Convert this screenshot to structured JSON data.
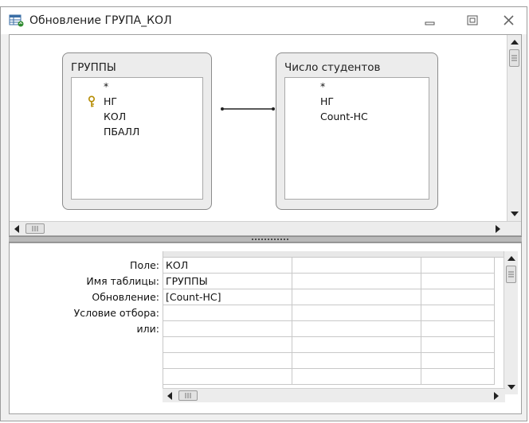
{
  "window": {
    "title": "Обновление ГРУПА_КОЛ"
  },
  "icons": {
    "title": "query-update-icon",
    "minimize": "minimize-icon",
    "maximize": "restore-icon",
    "close": "close-icon",
    "key": "primary-key-icon"
  },
  "tables": [
    {
      "name": "ГРУППЫ",
      "fields": [
        "*",
        "НГ",
        "КОЛ",
        "ПБАЛЛ"
      ]
    },
    {
      "name": "Число студентов",
      "fields": [
        "*",
        "НГ",
        "Count-НС"
      ]
    }
  ],
  "grid": {
    "row_labels": [
      "Поле:",
      "Имя таблицы:",
      "Обновление:",
      "Условие отбора:",
      "или:"
    ],
    "columns": [
      {
        "field": "КОЛ",
        "table": "ГРУППЫ",
        "update": "[Count-НС]",
        "criteria": "",
        "or": ""
      },
      {
        "field": "",
        "table": "",
        "update": "",
        "criteria": "",
        "or": ""
      },
      {
        "field": "",
        "table": "",
        "update": "",
        "criteria": "",
        "or": ""
      }
    ]
  }
}
